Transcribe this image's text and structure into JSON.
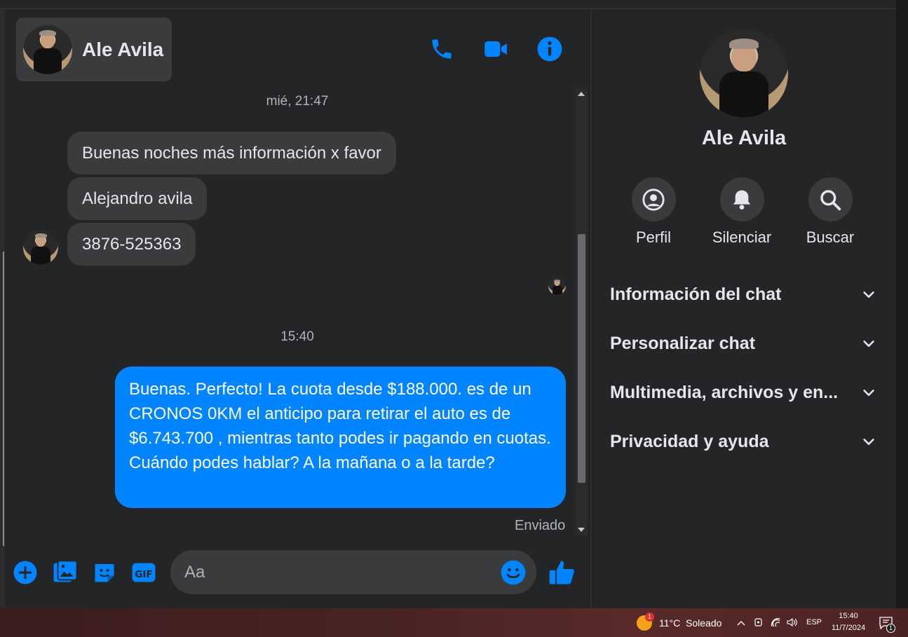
{
  "contact": {
    "name": "Ale Avila"
  },
  "messages": {
    "timestamp_1": "mié, 21:47",
    "incoming": [
      "Buenas noches más información x favor",
      "Alejandro avila",
      "3876-525363"
    ],
    "timestamp_2": "15:40",
    "outgoing": "Buenas. Perfecto! La cuota desde $188.000. es de un CRONOS 0KM el anticipo para retirar el auto es de $6.743.700 , mientras tanto podes ir pagando en cuotas. Cuándo podes hablar? A la mañana o a la tarde?",
    "status": "Enviado"
  },
  "composer": {
    "placeholder": "Aa"
  },
  "sidebar": {
    "name": "Ale Avila",
    "actions": [
      {
        "label": "Perfil",
        "icon": "profile-icon"
      },
      {
        "label": "Silenciar",
        "icon": "bell-icon"
      },
      {
        "label": "Buscar",
        "icon": "search-icon"
      }
    ],
    "sections": [
      "Información del chat",
      "Personalizar chat",
      "Multimedia, archivos y en...",
      "Privacidad y ayuda"
    ]
  },
  "taskbar": {
    "weather": "11°C  Soleado",
    "weather_badge": "1",
    "language": "ESP",
    "time": "15:40",
    "date": "11/7/2024",
    "notification_count": "1"
  },
  "colors": {
    "accent": "#0084ff",
    "background": "#242526",
    "bubble_in": "#3a3b3c",
    "text": "#e4e6eb"
  }
}
